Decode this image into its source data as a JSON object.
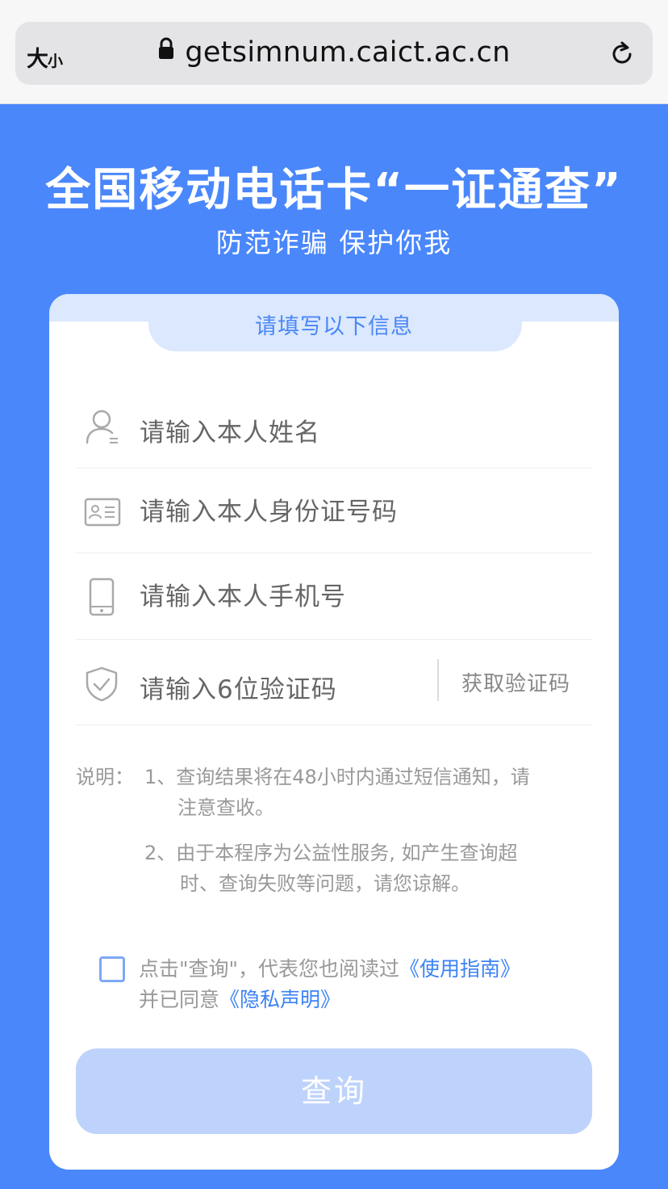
{
  "browser": {
    "text_size_big": "大",
    "text_size_small": "小",
    "url": "getsimnum.caict.ac.cn"
  },
  "hero": {
    "title": "全国移动电话卡“一证通查”",
    "subtitle": "防范诈骗 保护你我"
  },
  "form": {
    "header": "请填写以下信息",
    "name_placeholder": "请输入本人姓名",
    "id_placeholder": "请输入本人身份证号码",
    "phone_placeholder": "请输入本人手机号",
    "code_placeholder": "请输入6位验证码",
    "get_code_label": "获取验证码"
  },
  "notes": {
    "prefix": "说明：",
    "item1_line1": "1、查询结果将在48小时内通过短信通知，请",
    "item1_line2": "注意查收。",
    "item2_line1": "2、由于本程序为公益性服务, 如产生查询超",
    "item2_line2": "时、查询失败等问题，请您谅解。"
  },
  "agreement": {
    "text_before": "点击\"查询\"，代表您也阅读过",
    "guide_link": "《使用指南》",
    "text_middle": "并已同意",
    "privacy_link": "《隐私声明》",
    "checked": false
  },
  "submit": {
    "label": "查询"
  },
  "colors": {
    "background": "#4a87fb",
    "accent": "#4a87f6",
    "button_disabled": "#bed3fb",
    "link": "#3b82f6"
  },
  "icons": [
    "lock-icon",
    "reload-icon",
    "user-icon",
    "id-card-icon",
    "phone-icon",
    "shield-check-icon"
  ]
}
